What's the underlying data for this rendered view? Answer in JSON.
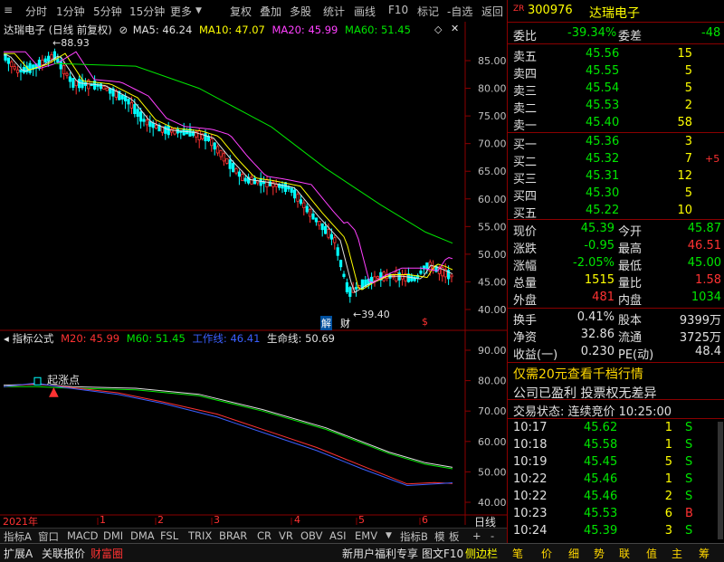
{
  "toolbar": {
    "left": [
      "分时",
      "1分钟",
      "5分钟",
      "15分钟",
      "更多"
    ],
    "right": [
      "复权",
      "叠加",
      "多股",
      "统计",
      "画线",
      "F10",
      "标记",
      "-自选",
      "返回"
    ]
  },
  "chart": {
    "title": "达瑞电子 (日线 前复权)",
    "ma5_label": "MA5: 46.24",
    "ma10_label": "MA10: 47.07",
    "ma20_label": "MA20: 45.99",
    "ma60_label": "MA60: 51.45",
    "high_marker": "88.93",
    "low_marker": "39.40",
    "jie": "解",
    "cai": "财",
    "dollar": "$",
    "yticks": [
      "85.00",
      "80.00",
      "75.00",
      "70.00",
      "65.00",
      "60.00",
      "55.00",
      "50.00",
      "45.00",
      "40.00"
    ],
    "colors": {
      "up": "#ff3232",
      "down": "#00ffff",
      "ma5": "#e0e0e0",
      "ma10": "#ffff00",
      "ma20": "#ff40ff",
      "ma60": "#00e600"
    }
  },
  "indicator": {
    "name": "指标公式",
    "m20": "M20: 45.99",
    "m60": "M60: 51.45",
    "gongzuo": "工作线: 46.41",
    "shengming": "生命线: 50.69",
    "qizhangdian": "起涨点",
    "yticks": [
      "90.00",
      "80.00",
      "70.00",
      "60.00",
      "50.00",
      "40.00"
    ]
  },
  "xaxis": {
    "year": "2021年",
    "months": [
      "1",
      "2",
      "3",
      "4",
      "5",
      "6"
    ],
    "period": "日线"
  },
  "bottom_tabs": [
    "指标A",
    "窗口",
    "MACD",
    "DMI",
    "DMA",
    "FSL",
    "TRIX",
    "BRAR",
    "CR",
    "VR",
    "OBV",
    "ASI",
    "EMV"
  ],
  "bottom_right_tabs": [
    "指标B",
    "模",
    "板",
    "+",
    "-"
  ],
  "footer": {
    "left": [
      "扩展A",
      "关联报价",
      "财富圈"
    ],
    "mid": [
      "新用户福利专享",
      "图文F10",
      "侧边栏"
    ],
    "right": [
      "笔",
      "价",
      "细",
      "势",
      "联",
      "值",
      "主",
      "筹"
    ]
  },
  "quote": {
    "code": "300976",
    "name": "达瑞电子",
    "zr": "ZR",
    "weibi_label": "委比",
    "weibi": "-39.34%",
    "weicha_label": "委差",
    "weicha": "-48",
    "asks": [
      {
        "label": "卖五",
        "price": "45.56",
        "vol": "15"
      },
      {
        "label": "卖四",
        "price": "45.55",
        "vol": "5"
      },
      {
        "label": "卖三",
        "price": "45.54",
        "vol": "5"
      },
      {
        "label": "卖二",
        "price": "45.53",
        "vol": "2"
      },
      {
        "label": "卖一",
        "price": "45.40",
        "vol": "58"
      }
    ],
    "bids": [
      {
        "label": "买一",
        "price": "45.36",
        "vol": "3",
        "chg": ""
      },
      {
        "label": "买二",
        "price": "45.32",
        "vol": "7",
        "chg": "+5"
      },
      {
        "label": "买三",
        "price": "45.31",
        "vol": "12",
        "chg": ""
      },
      {
        "label": "买四",
        "price": "45.30",
        "vol": "5",
        "chg": ""
      },
      {
        "label": "买五",
        "price": "45.22",
        "vol": "10",
        "chg": ""
      }
    ],
    "stats": [
      {
        "l1": "现价",
        "v1": "45.39",
        "c1": "green",
        "l2": "今开",
        "v2": "45.87",
        "c2": "green"
      },
      {
        "l1": "涨跌",
        "v1": "-0.95",
        "c1": "green",
        "l2": "最高",
        "v2": "46.51",
        "c2": "red"
      },
      {
        "l1": "涨幅",
        "v1": "-2.05%",
        "c1": "green",
        "l2": "最低",
        "v2": "45.00",
        "c2": "green"
      },
      {
        "l1": "总量",
        "v1": "1515",
        "c1": "yellow",
        "l2": "量比",
        "v2": "1.58",
        "c2": "red"
      },
      {
        "l1": "外盘",
        "v1": "481",
        "c1": "red",
        "l2": "内盘",
        "v2": "1034",
        "c2": "green"
      }
    ],
    "stats2": [
      {
        "l1": "换手",
        "v1": "0.41%",
        "l2": "股本",
        "v2": "9399万"
      },
      {
        "l1": "净资",
        "v1": "32.86",
        "l2": "流通",
        "v2": "3725万"
      },
      {
        "l1": "收益(一)",
        "v1": "0.230",
        "l2": "PE(动)",
        "v2": "48.4"
      }
    ],
    "promo": "仅需20元查看千档行情",
    "notice": "公司已盈利 投票权无差异",
    "status": "交易状态: 连续竞价 10:25:00",
    "ticks": [
      {
        "t": "10:17",
        "p": "45.62",
        "v": "1",
        "d": "S"
      },
      {
        "t": "10:18",
        "p": "45.58",
        "v": "1",
        "d": "S"
      },
      {
        "t": "10:19",
        "p": "45.45",
        "v": "5",
        "d": "S"
      },
      {
        "t": "10:22",
        "p": "45.46",
        "v": "1",
        "d": "S"
      },
      {
        "t": "10:22",
        "p": "45.46",
        "v": "2",
        "d": "S"
      },
      {
        "t": "10:23",
        "p": "45.53",
        "v": "6",
        "d": "B"
      },
      {
        "t": "10:24",
        "p": "45.39",
        "v": "3",
        "d": "S"
      }
    ]
  }
}
